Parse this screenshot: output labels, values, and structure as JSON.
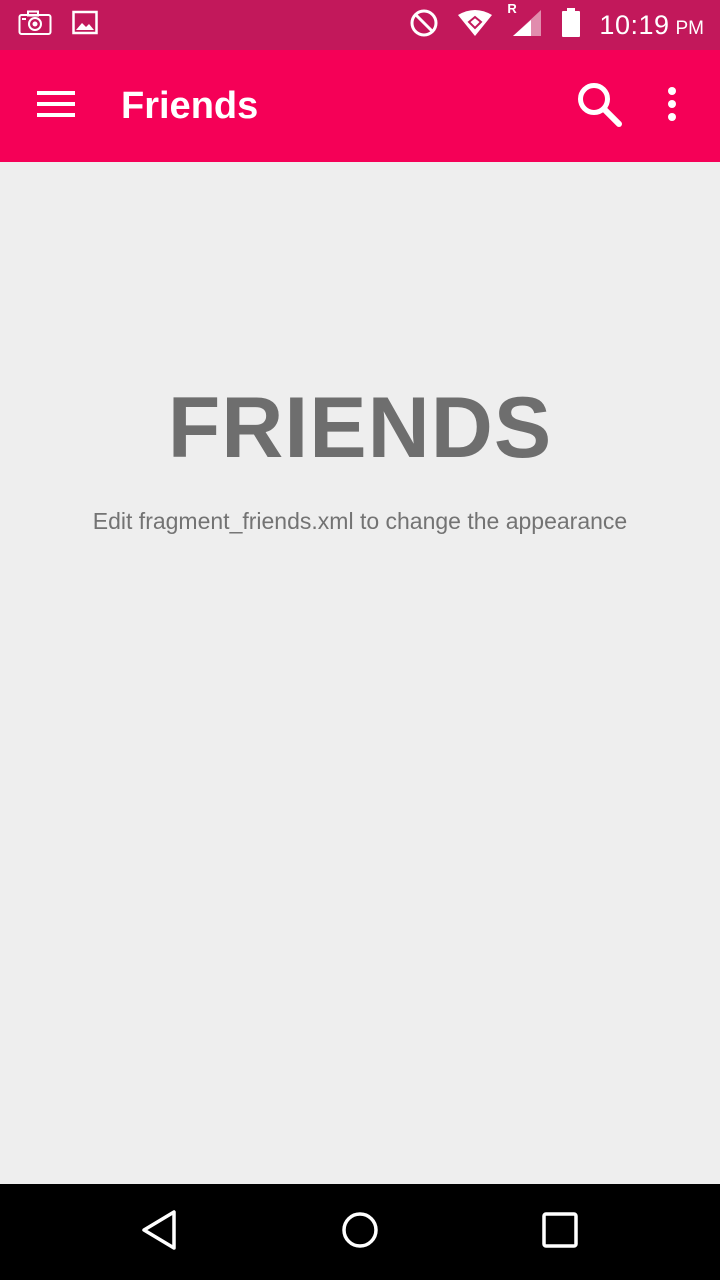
{
  "status_bar": {
    "time": "10:19",
    "ampm": "PM",
    "left_icons": [
      "camera-icon",
      "gallery-icon"
    ],
    "right_icons": [
      "do-not-disturb-icon",
      "wifi-icon",
      "cellular-signal-icon",
      "battery-icon"
    ],
    "roaming_indicator": "R",
    "background_color": "#c2185b"
  },
  "app_bar": {
    "title": "Friends",
    "background_color": "#f50057",
    "actions": [
      "search-icon",
      "overflow-menu-icon"
    ]
  },
  "content": {
    "heading": "FRIENDS",
    "hint": "Edit fragment_friends.xml to change the appearance",
    "background_color": "#eeeeee"
  },
  "navigation_bar": {
    "buttons": [
      "back-icon",
      "home-icon",
      "recents-icon"
    ]
  }
}
